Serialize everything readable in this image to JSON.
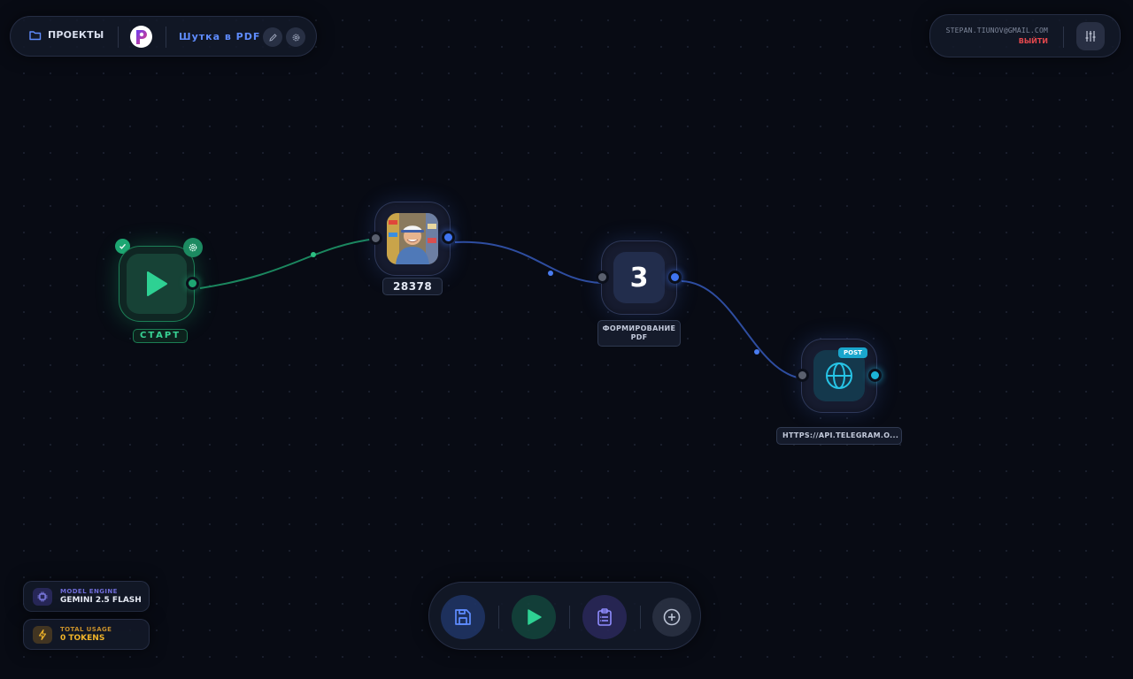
{
  "topbar": {
    "projects_label": "ПРОЕКТЫ",
    "project_title": "Шутка в PDF"
  },
  "user": {
    "email": "STEPAN.TIUNOV@GMAIL.COM",
    "logout_label": "ВЫЙТИ"
  },
  "nodes": {
    "start": {
      "label": "СТАРТ"
    },
    "image": {
      "label": "28378"
    },
    "format": {
      "value": "3",
      "label": "ФОРМИРОВАНИЕ PDF"
    },
    "http": {
      "method": "POST",
      "label": "HTTPS://API.TELEGRAM.O..."
    }
  },
  "info": {
    "model_caption": "MODEL ENGINE",
    "model_value": "GEMINI 2.5 FLASH",
    "usage_caption": "TOTAL USAGE",
    "usage_value": "0 TOKENS"
  },
  "toolbar": {
    "icons": [
      "save-icon",
      "play-icon",
      "clipboard-icon",
      "plus-circle-icon"
    ]
  },
  "colors": {
    "background": "#080b14",
    "accent_blue": "#3f74f0",
    "accent_green": "#1ea672",
    "accent_cyan": "#1cb3d6",
    "logout_red": "#e5484d",
    "usage_amber": "#f0b429"
  }
}
